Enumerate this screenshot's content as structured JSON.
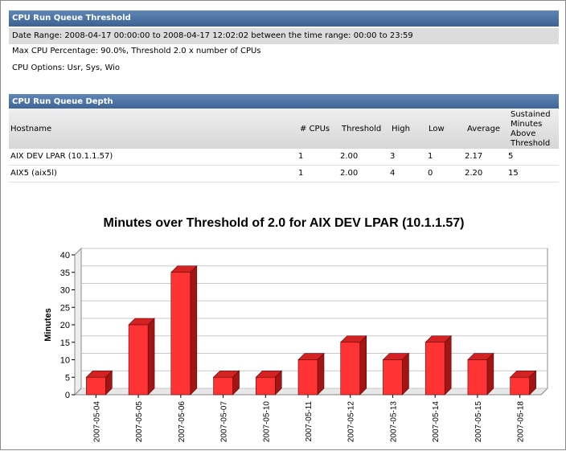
{
  "threshold_section": {
    "title": "CPU Run Queue Threshold",
    "date_range": "Date Range: 2008-04-17 00:00:00 to 2008-04-17 12:02:02 between the time range: 00:00 to 23:59",
    "max_cpu": "Max CPU Percentage: 90.0%, Threshold 2.0 x number of CPUs",
    "cpu_options": "CPU Options: Usr, Sys, Wio"
  },
  "depth_section": {
    "title": "CPU Run Queue Depth",
    "columns": {
      "hostname": "Hostname",
      "cpus": "# CPUs",
      "threshold": "Threshold",
      "high": "High",
      "low": "Low",
      "average": "Average",
      "sustained_lines": [
        "Sustained",
        "Minutes",
        "Above",
        "Threshold"
      ]
    },
    "rows": [
      {
        "hostname": "AIX DEV LPAR (10.1.1.57)",
        "cpus": "1",
        "threshold": "2.00",
        "high": "3",
        "low": "1",
        "average": "2.17",
        "sustained": "5"
      },
      {
        "hostname": "AIX5 (aix5l)",
        "cpus": "1",
        "threshold": "2.00",
        "high": "4",
        "low": "0",
        "average": "2.20",
        "sustained": "15"
      }
    ]
  },
  "chart_data": {
    "type": "bar",
    "title": "Minutes over Threshold of 2.0 for AIX DEV LPAR (10.1.1.57)",
    "xlabel": "",
    "ylabel": "Minutes",
    "categories": [
      "2007-05-04",
      "2007-05-05",
      "2007-05-06",
      "2007-05-07",
      "2007-05-10",
      "2007-05-11",
      "2007-05-12",
      "2007-05-13",
      "2007-05-14",
      "2007-05-15",
      "2007-05-18"
    ],
    "values": [
      5,
      20,
      35,
      5,
      5,
      10,
      15,
      10,
      15,
      10,
      5
    ],
    "ylim": [
      0,
      40
    ],
    "yticks": [
      0,
      5,
      10,
      15,
      20,
      25,
      30,
      35,
      40
    ],
    "grid": true,
    "bar_color": "#ff3333",
    "bar_side_color": "#a31515",
    "bar_top_color": "#d42222"
  }
}
